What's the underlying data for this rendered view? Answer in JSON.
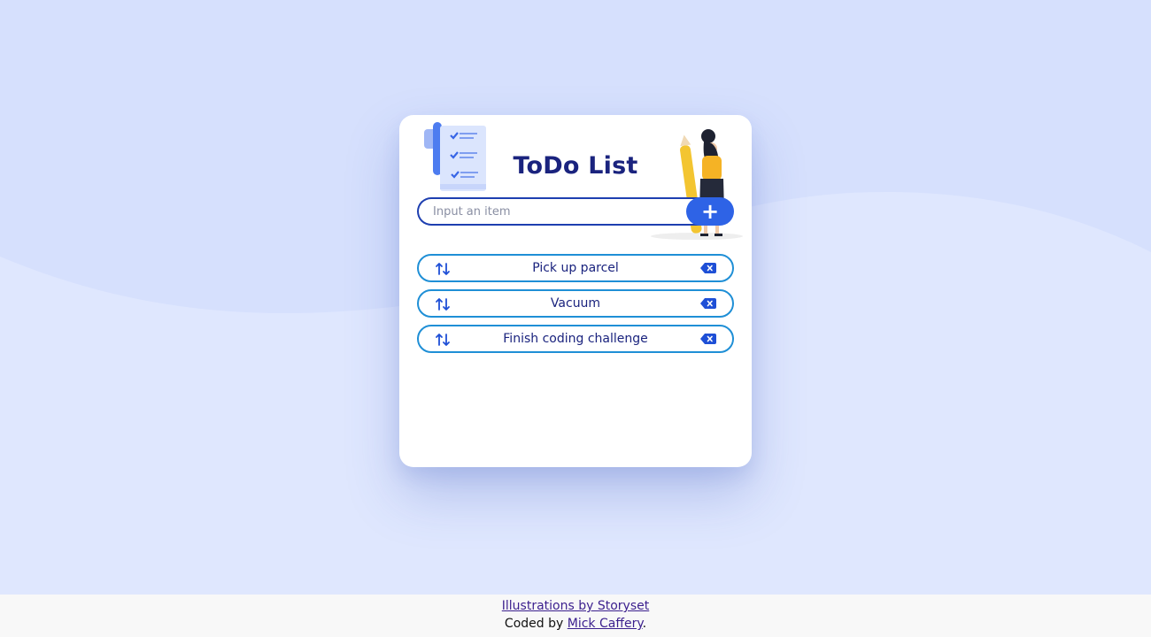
{
  "app": {
    "title": "ToDo List"
  },
  "input": {
    "placeholder": "Input an item",
    "value": "",
    "add_button_label": "+"
  },
  "todos": [
    {
      "text": "Pick up parcel"
    },
    {
      "text": "Vacuum"
    },
    {
      "text": "Finish coding challenge"
    }
  ],
  "icons": {
    "sort": "sort-arrows-icon",
    "delete": "backspace-delete-icon",
    "add": "plus-icon"
  },
  "footer": {
    "credit_link": "Illustrations by Storyset",
    "coded_prefix": "Coded by ",
    "author_link": "Mick Caffery",
    "coded_suffix": "."
  },
  "colors": {
    "background": "#d9e3fd",
    "title": "#1a237e",
    "accent": "#2e63e6",
    "item_border": "#1f8fd6",
    "input_border": "#1e3fb0"
  }
}
